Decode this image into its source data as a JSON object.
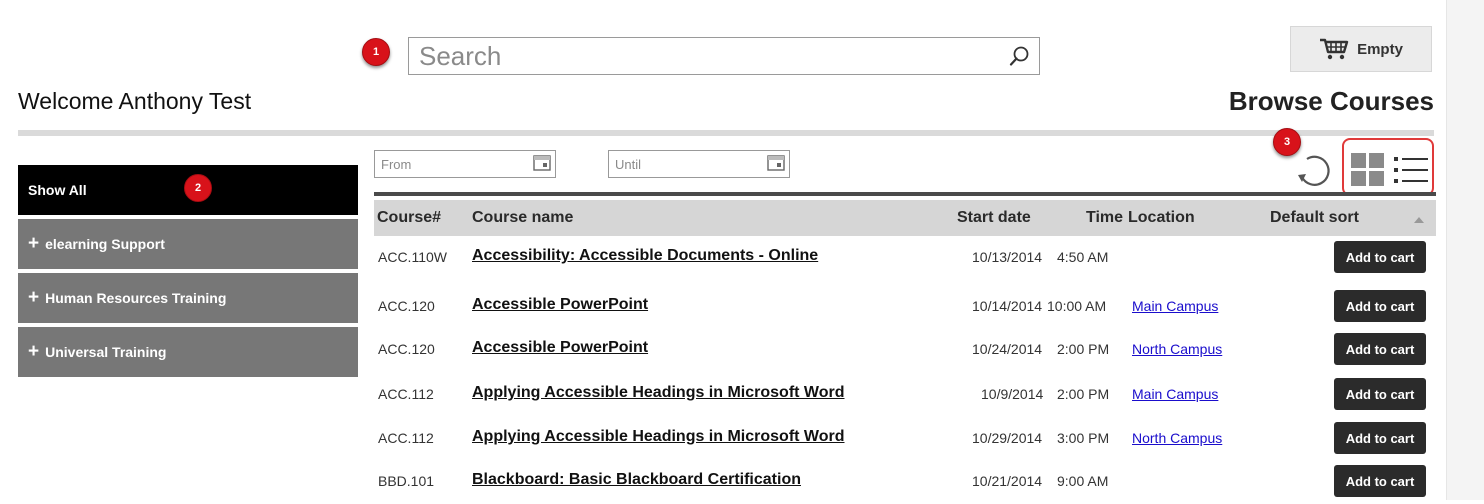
{
  "header": {
    "search_placeholder": "Search",
    "cart_label": "Empty",
    "welcome": "Welcome Anthony Test",
    "browse_title": "Browse Courses"
  },
  "badges": [
    "1",
    "2",
    "3"
  ],
  "sidebar": {
    "items": [
      {
        "label": "Show All",
        "active": true
      },
      {
        "label": "elearning Support",
        "prefix": "+"
      },
      {
        "label": "Human Resources Training",
        "prefix": "+"
      },
      {
        "label": "Universal Training",
        "prefix": "+"
      }
    ]
  },
  "filters": {
    "from_placeholder": "From",
    "until_placeholder": "Until"
  },
  "table": {
    "columns": [
      "Course#",
      "Course name",
      "Start date",
      "Time",
      "Location",
      "Default sort"
    ],
    "rows": [
      {
        "num": "ACC.110W",
        "name": "Accessibility: Accessible Documents - Online",
        "date": "10/13/2014",
        "time": "4:50 AM",
        "location": "",
        "action": "Add to cart"
      },
      {
        "num": "ACC.120",
        "name": "Accessible PowerPoint",
        "date": "10/14/2014",
        "time": "10:00 AM",
        "location": "Main Campus",
        "action": "Add to cart"
      },
      {
        "num": "ACC.120",
        "name": "Accessible PowerPoint",
        "date": "10/24/2014",
        "time": "2:00 PM",
        "location": "North Campus",
        "action": "Add to cart"
      },
      {
        "num": "ACC.112",
        "name": "Applying Accessible Headings in Microsoft Word",
        "date": "10/9/2014",
        "time": "2:00 PM",
        "location": "Main Campus",
        "action": "Add to cart"
      },
      {
        "num": "ACC.112",
        "name": "Applying Accessible Headings in Microsoft Word",
        "date": "10/29/2014",
        "time": "3:00 PM",
        "location": "North Campus",
        "action": "Add to cart"
      },
      {
        "num": "BBD.101",
        "name": "Blackboard: Basic Blackboard Certification",
        "date": "10/21/2014",
        "time": "9:00 AM",
        "location": "",
        "action": "Add to cart"
      }
    ]
  },
  "icons": {
    "search": "search-icon",
    "cart": "shopping-cart-icon",
    "calendar": "calendar-icon",
    "refresh": "refresh-icon",
    "grid": "grid-view-icon",
    "list": "list-view-icon"
  },
  "colors": {
    "badge": "#d8121a",
    "link": "#1a0dcc",
    "sidebar_active": "#000000",
    "sidebar_item": "#777777",
    "button": "#2b2b2b"
  }
}
